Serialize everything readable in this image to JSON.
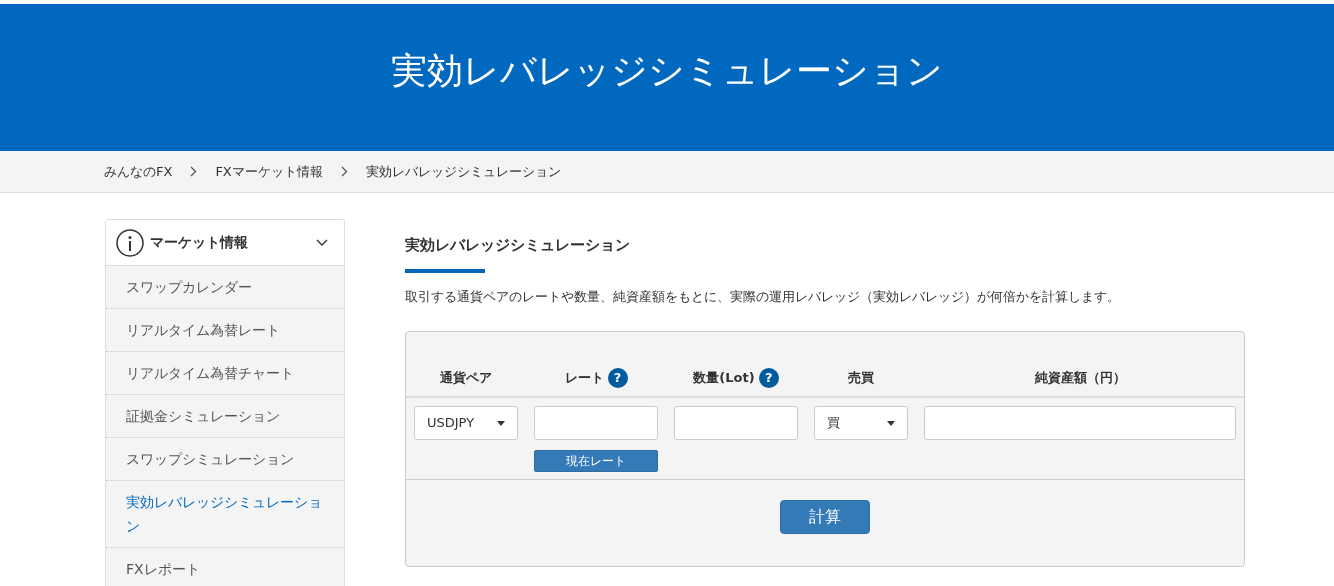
{
  "banner": {
    "title": "実効レバレッジシミュレーション"
  },
  "breadcrumbs": [
    {
      "label": "みんなのFX"
    },
    {
      "label": "FXマーケット情報"
    },
    {
      "label": "実効レバレッジシミュレーション"
    }
  ],
  "sidebar": {
    "header": "マーケット情報",
    "expanded": true,
    "items": [
      {
        "label": "スワップカレンダー",
        "selected": false
      },
      {
        "label": "リアルタイム為替レート",
        "selected": false
      },
      {
        "label": "リアルタイム為替チャート",
        "selected": false
      },
      {
        "label": "証拠金シミュレーション",
        "selected": false
      },
      {
        "label": "スワップシミュレーション",
        "selected": false
      },
      {
        "label": "実効レバレッジシミュレーション",
        "selected": true
      },
      {
        "label": "FXレポート",
        "selected": false
      }
    ]
  },
  "section": {
    "title": "実効レバレッジシミュレーション",
    "description": "取引する通貨ペアのレートや数量、純資産額をもとに、実際の運用レバレッジ（実効レバレッジ）が何倍かを計算します。"
  },
  "form": {
    "columns": [
      {
        "label": "通貨ペア",
        "kind": "select",
        "value": "USDJPY"
      },
      {
        "label": "レート",
        "help": "?",
        "kind": "input",
        "button": "現在レート"
      },
      {
        "label": "数量(Lot)",
        "help": "?",
        "kind": "input"
      },
      {
        "label": "売買",
        "kind": "select",
        "value": "買"
      },
      {
        "label": "純資産額（円）",
        "kind": "input"
      }
    ],
    "submit": "計算"
  }
}
